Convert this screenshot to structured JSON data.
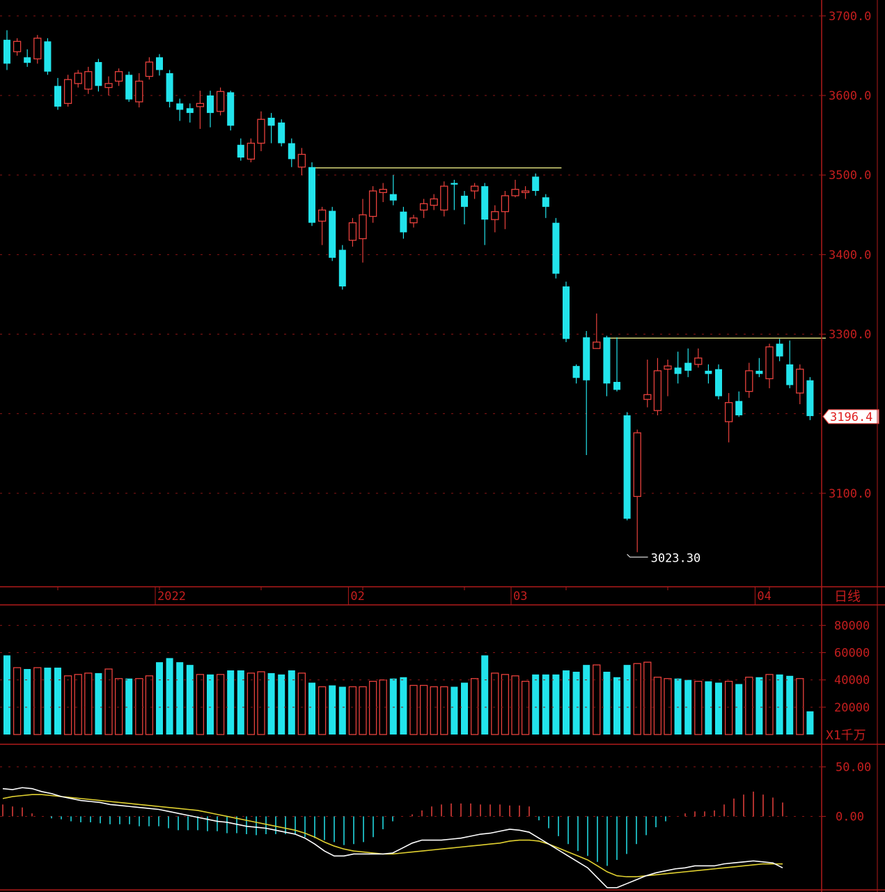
{
  "chart_data": [
    {
      "type": "candlestick",
      "period_label": "日线",
      "y_ticks": [
        "3700.0",
        "3600.0",
        "3500.0",
        "3400.0",
        "3300.0",
        "3100.0"
      ],
      "y_tick_values": [
        3700,
        3600,
        3500,
        3400,
        3300,
        3100
      ],
      "ylim": [
        2986,
        3720
      ],
      "x_tick_labels": [
        {
          "label": "2022",
          "index": 15
        },
        {
          "label": "02",
          "index": 34
        },
        {
          "label": "03",
          "index": 50
        },
        {
          "label": "04",
          "index": 74
        }
      ],
      "last_price": "3196.4",
      "low_annotation": "3023.30",
      "low_annotation_index": 61,
      "low_annotation_value": 3023.3,
      "resistance_lines": [
        {
          "start_index": 30,
          "end_index": 54,
          "value": 3509
        },
        {
          "start_index": 59,
          "end_index": 80,
          "value": 3295
        }
      ],
      "colors": {
        "up": "#e8413c",
        "down": "#22e4ec",
        "resistance": "#d6d67a",
        "grid": "#8a1414",
        "axis": "#b01a1a",
        "label": "#c41e1e"
      },
      "candles": [
        [
          3670,
          3640,
          3682,
          3632
        ],
        [
          3655,
          3668,
          3672,
          3650
        ],
        [
          3648,
          3641,
          3658,
          3636
        ],
        [
          3646,
          3672,
          3676,
          3640
        ],
        [
          3668,
          3630,
          3672,
          3626
        ],
        [
          3612,
          3586,
          3622,
          3582
        ],
        [
          3590,
          3620,
          3626,
          3586
        ],
        [
          3615,
          3628,
          3632,
          3610
        ],
        [
          3608,
          3630,
          3636,
          3602
        ],
        [
          3642,
          3612,
          3646,
          3605
        ],
        [
          3610,
          3615,
          3624,
          3600
        ],
        [
          3618,
          3630,
          3634,
          3612
        ],
        [
          3626,
          3595,
          3630,
          3592
        ],
        [
          3592,
          3618,
          3628,
          3585
        ],
        [
          3624,
          3642,
          3648,
          3620
        ],
        [
          3648,
          3632,
          3652,
          3625
        ],
        [
          3628,
          3592,
          3632,
          3585
        ],
        [
          3590,
          3582,
          3596,
          3568
        ],
        [
          3584,
          3578,
          3590,
          3566
        ],
        [
          3586,
          3590,
          3606,
          3558
        ],
        [
          3600,
          3578,
          3606,
          3560
        ],
        [
          3580,
          3605,
          3610,
          3575
        ],
        [
          3604,
          3562,
          3606,
          3556
        ],
        [
          3538,
          3522,
          3546,
          3518
        ],
        [
          3520,
          3540,
          3546,
          3516
        ],
        [
          3540,
          3570,
          3580,
          3530
        ],
        [
          3572,
          3562,
          3578,
          3540
        ],
        [
          3566,
          3540,
          3570,
          3536
        ],
        [
          3540,
          3520,
          3546,
          3510
        ],
        [
          3510,
          3526,
          3534,
          3500
        ],
        [
          3510,
          3440,
          3516,
          3436
        ],
        [
          3442,
          3456,
          3460,
          3412
        ],
        [
          3455,
          3396,
          3460,
          3392
        ],
        [
          3406,
          3360,
          3412,
          3356
        ],
        [
          3418,
          3440,
          3446,
          3410
        ],
        [
          3420,
          3450,
          3470,
          3390
        ],
        [
          3448,
          3480,
          3486,
          3440
        ],
        [
          3478,
          3482,
          3490,
          3466
        ],
        [
          3476,
          3468,
          3500,
          3462
        ],
        [
          3454,
          3428,
          3460,
          3420
        ],
        [
          3440,
          3446,
          3450,
          3434
        ],
        [
          3456,
          3464,
          3470,
          3446
        ],
        [
          3462,
          3470,
          3476,
          3456
        ],
        [
          3456,
          3486,
          3492,
          3448
        ],
        [
          3490,
          3488,
          3494,
          3456
        ],
        [
          3474,
          3460,
          3480,
          3438
        ],
        [
          3480,
          3486,
          3490,
          3470
        ],
        [
          3486,
          3444,
          3490,
          3412
        ],
        [
          3444,
          3454,
          3462,
          3428
        ],
        [
          3454,
          3474,
          3480,
          3432
        ],
        [
          3474,
          3482,
          3494,
          3472
        ],
        [
          3478,
          3480,
          3486,
          3470
        ],
        [
          3498,
          3480,
          3502,
          3474
        ],
        [
          3472,
          3460,
          3476,
          3446
        ],
        [
          3440,
          3376,
          3446,
          3370
        ],
        [
          3360,
          3294,
          3366,
          3290
        ],
        [
          3260,
          3245,
          3262,
          3238
        ],
        [
          3296,
          3242,
          3304,
          3148
        ],
        [
          3282,
          3290,
          3326,
          3284
        ],
        [
          3296,
          3238,
          3298,
          3222
        ],
        [
          3240,
          3230,
          3296,
          3228
        ],
        [
          3198,
          3068,
          3202,
          3066
        ],
        [
          3096,
          3176,
          3180,
          3026
        ],
        [
          3218,
          3224,
          3268,
          3208
        ],
        [
          3204,
          3254,
          3270,
          3198
        ],
        [
          3256,
          3260,
          3268,
          3222
        ],
        [
          3258,
          3250,
          3278,
          3238
        ],
        [
          3264,
          3254,
          3282,
          3246
        ],
        [
          3262,
          3270,
          3282,
          3258
        ],
        [
          3254,
          3250,
          3262,
          3238
        ],
        [
          3256,
          3222,
          3262,
          3218
        ],
        [
          3190,
          3214,
          3226,
          3164
        ],
        [
          3216,
          3198,
          3228,
          3196
        ],
        [
          3228,
          3254,
          3264,
          3220
        ],
        [
          3254,
          3250,
          3270,
          3246
        ],
        [
          3244,
          3284,
          3288,
          3232
        ],
        [
          3288,
          3272,
          3294,
          3266
        ],
        [
          3262,
          3236,
          3292,
          3232
        ],
        [
          3226,
          3256,
          3262,
          3212
        ],
        [
          3242,
          3197,
          3246,
          3192
        ]
      ]
    },
    {
      "type": "bar",
      "y_ticks": [
        "80000",
        "60000",
        "40000",
        "20000"
      ],
      "y_tick_values": [
        80000,
        60000,
        40000,
        20000
      ],
      "ylim": [
        0,
        95000
      ],
      "unit_label": "X1千万",
      "volumes": [
        58000,
        49000,
        48000,
        49000,
        49000,
        49000,
        43000,
        44000,
        45000,
        45000,
        48000,
        41000,
        41000,
        41000,
        43000,
        53000,
        56000,
        53000,
        51000,
        44000,
        44000,
        44000,
        47000,
        47000,
        45000,
        46000,
        45000,
        44000,
        47000,
        45000,
        38000,
        35000,
        36000,
        35000,
        35000,
        35000,
        39000,
        40000,
        41000,
        42000,
        36000,
        36000,
        35000,
        35000,
        35000,
        38000,
        41000,
        58000,
        45000,
        44000,
        43000,
        39000,
        44000,
        44000,
        44000,
        47000,
        46000,
        51000,
        51000,
        46000,
        42000,
        51000,
        52000,
        53000,
        42000,
        41000,
        41000,
        40000,
        39000,
        39000,
        38000,
        39000,
        37000,
        42000,
        42000,
        44000,
        44000,
        43000,
        41000,
        17000
      ]
    },
    {
      "type": "line",
      "y_ticks": [
        "50.00",
        "0.00"
      ],
      "y_tick_values": [
        50,
        0
      ],
      "ylim": [
        -75,
        70
      ],
      "macd_hist": [
        12,
        10,
        9,
        3,
        0,
        -2,
        -3,
        -5,
        -6,
        -6,
        -7,
        -8,
        -8,
        -8,
        -10,
        -10,
        -10,
        -12,
        -14,
        -14,
        -14,
        -15,
        -15,
        -17,
        -17,
        -18,
        -19,
        -18,
        -18,
        -18,
        -18,
        -21,
        -22,
        -24,
        -26,
        -29,
        -28,
        -26,
        -21,
        -13,
        -5,
        0,
        2,
        6,
        10,
        12,
        13,
        13,
        13,
        12,
        12,
        12,
        11,
        11,
        10,
        -4,
        -12,
        -20,
        -28,
        -35,
        -40,
        -46,
        -50,
        -44,
        -38,
        -28,
        -19,
        -11,
        -5,
        0,
        3,
        5,
        5,
        6,
        12,
        18,
        22,
        25,
        22,
        19,
        14
      ],
      "dif": [
        28,
        27,
        29,
        28,
        25,
        23,
        20,
        18,
        16,
        15,
        14,
        12,
        11,
        10,
        9,
        8,
        7,
        5,
        3,
        1,
        -1,
        -3,
        -5,
        -6,
        -8,
        -10,
        -11,
        -12,
        -14,
        -16,
        -18,
        -22,
        -28,
        -35,
        -40,
        -40,
        -38,
        -38,
        -38,
        -38,
        -37,
        -32,
        -27,
        -24,
        -24,
        -24,
        -23,
        -22,
        -20,
        -18,
        -17,
        -15,
        -13,
        -14,
        -16,
        -22,
        -28,
        -34,
        -40,
        -46,
        -52,
        -62,
        -72,
        -72,
        -68,
        -64,
        -60,
        -57,
        -55,
        -53,
        -52,
        -50,
        -50,
        -50,
        -48,
        -47,
        -46,
        -45,
        -46,
        -47,
        -52
      ],
      "dea": [
        18,
        20,
        21,
        22,
        22,
        21,
        20,
        19,
        18,
        17,
        16,
        15,
        14,
        13,
        12,
        11,
        10,
        9,
        8,
        7,
        6,
        4,
        2,
        0,
        -2,
        -4,
        -6,
        -8,
        -10,
        -12,
        -14,
        -17,
        -21,
        -26,
        -30,
        -33,
        -35,
        -36,
        -37,
        -38,
        -38,
        -37,
        -36,
        -35,
        -34,
        -33,
        -32,
        -31,
        -30,
        -29,
        -28,
        -27,
        -25,
        -24,
        -24,
        -25,
        -28,
        -32,
        -36,
        -40,
        -44,
        -50,
        -56,
        -60,
        -61,
        -61,
        -60,
        -59,
        -58,
        -57,
        -56,
        -55,
        -54,
        -53,
        -52,
        -51,
        -50,
        -49,
        -48,
        -48,
        -48
      ],
      "colors": {
        "hist_pos": "#e8413c",
        "hist_neg": "#22e4ec",
        "dif": "#ffffff",
        "dea": "#e0d030"
      }
    }
  ]
}
